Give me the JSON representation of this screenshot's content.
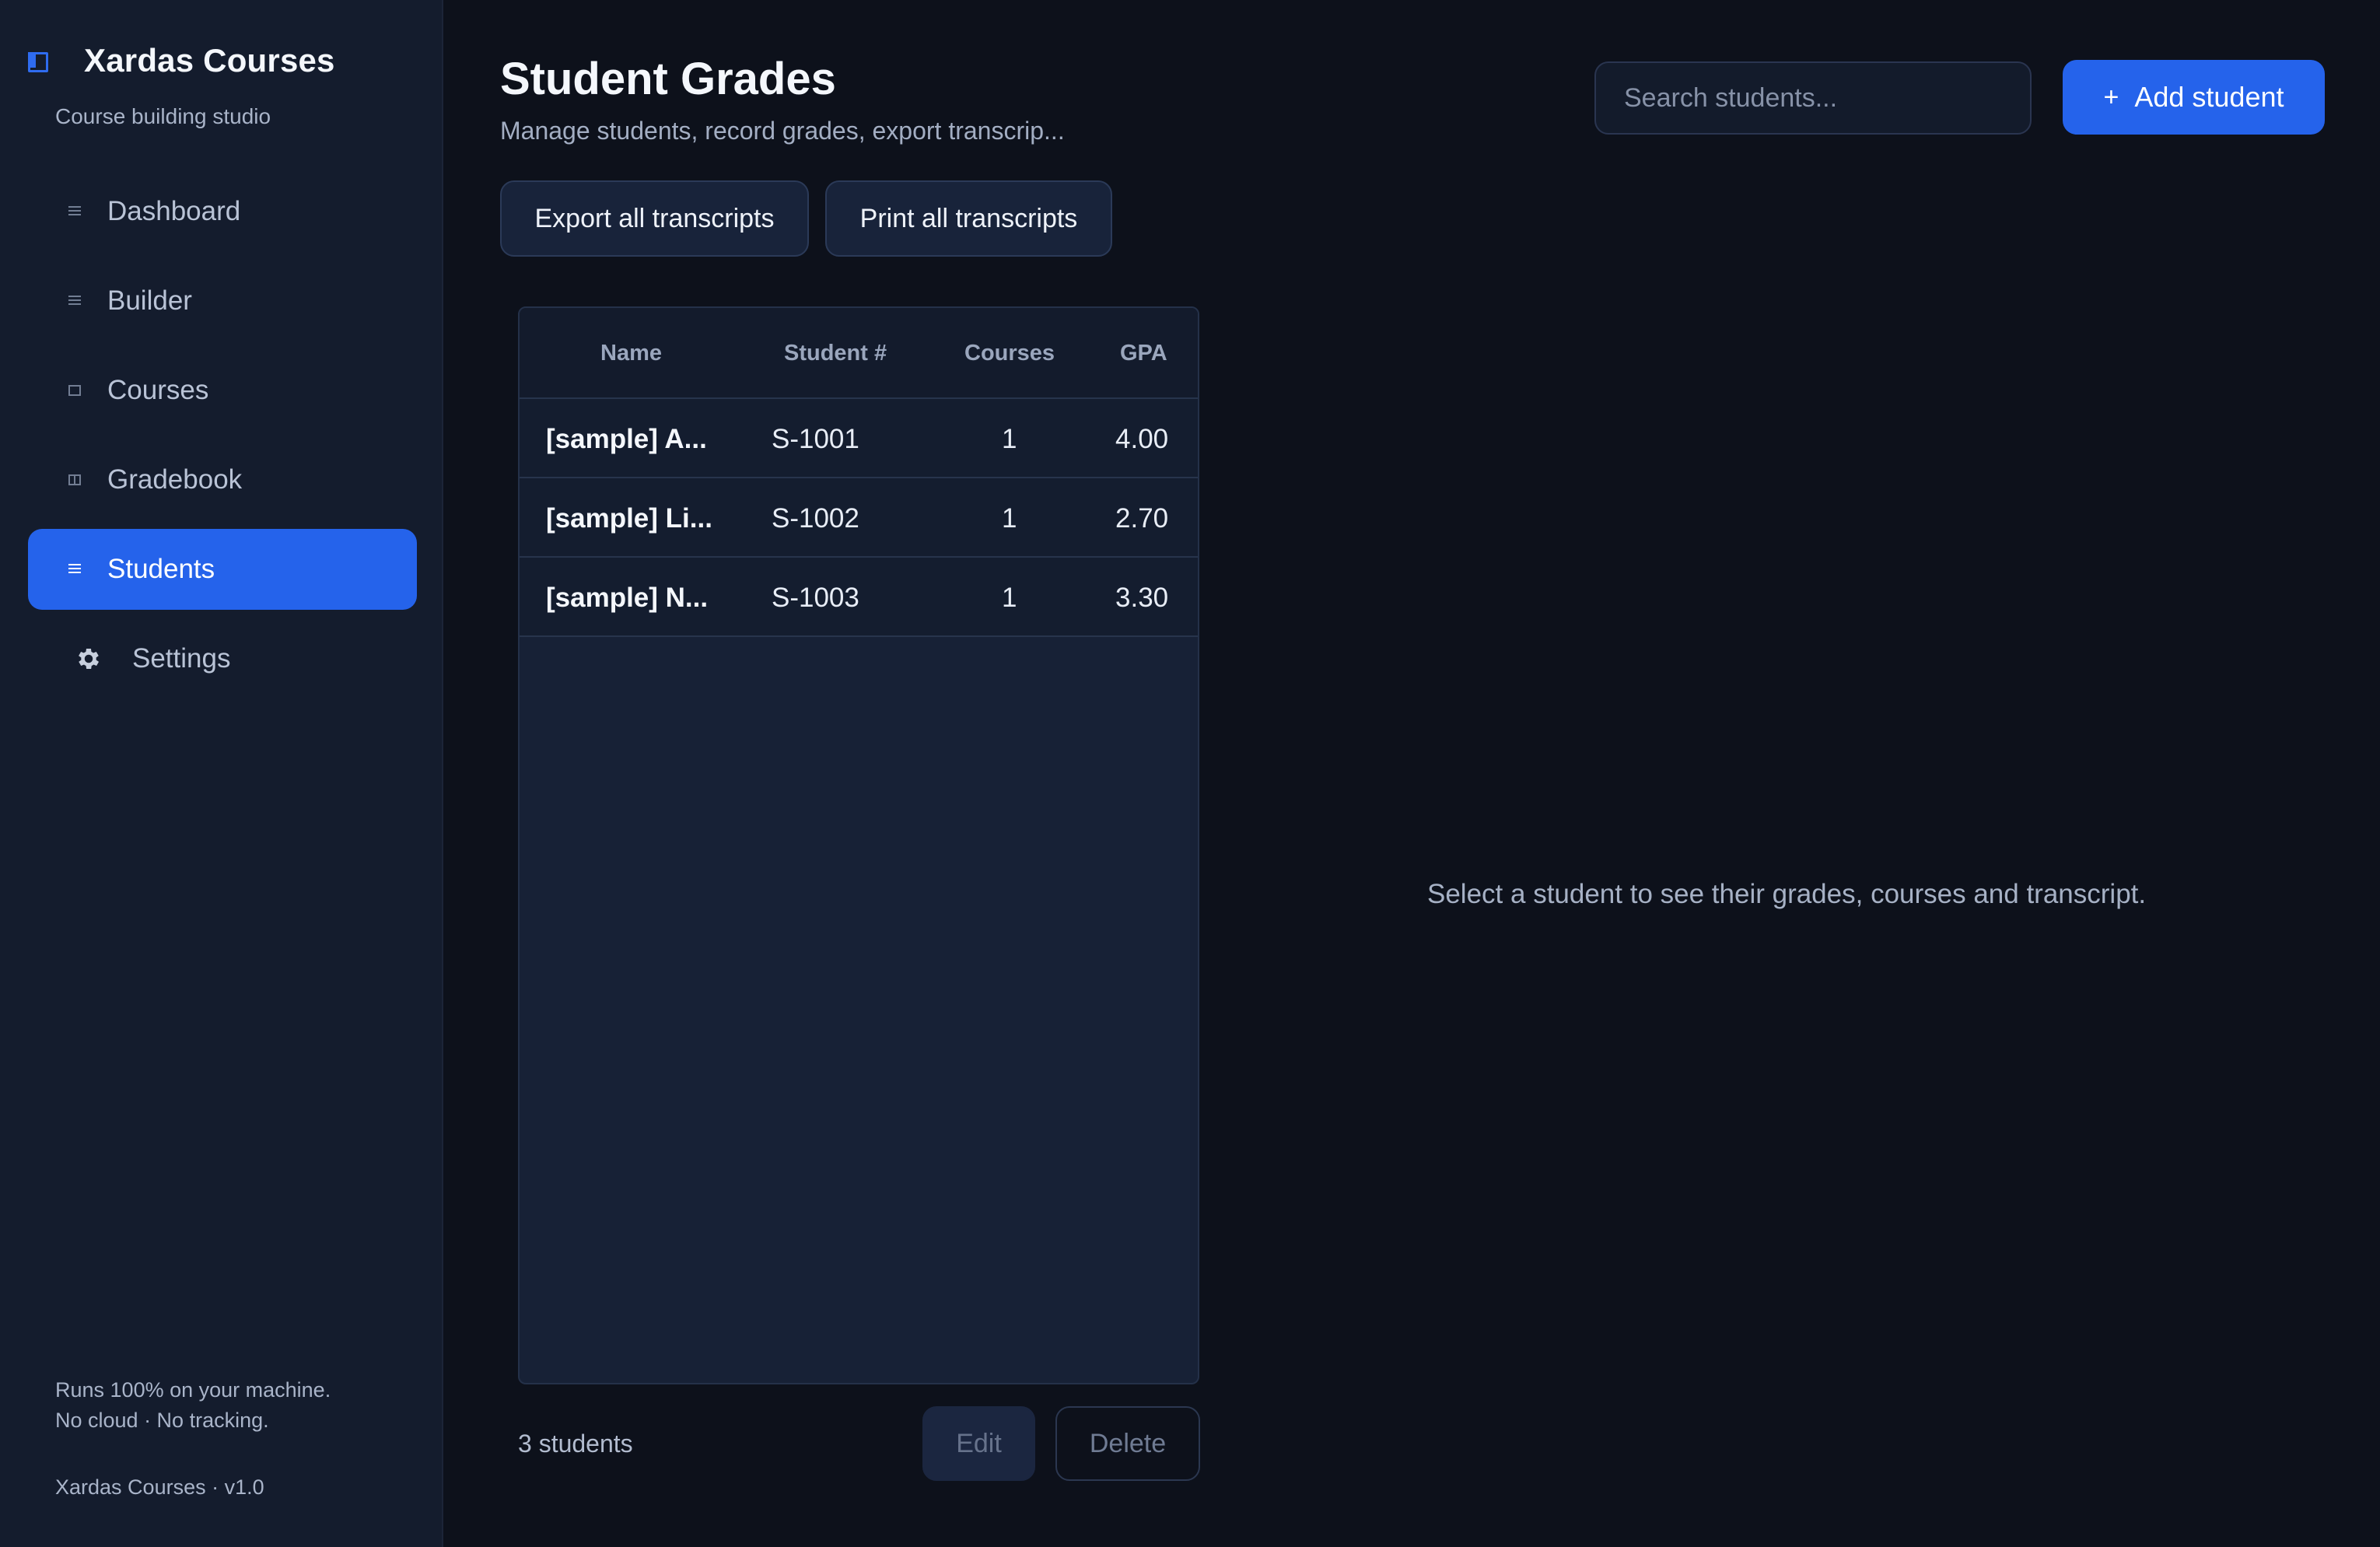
{
  "brand": {
    "title": "Xardas Courses",
    "subtitle": "Course building studio"
  },
  "nav": {
    "items": [
      {
        "label": "Dashboard",
        "icon": "dashboard-icon"
      },
      {
        "label": "Builder",
        "icon": "builder-icon"
      },
      {
        "label": "Courses",
        "icon": "courses-icon"
      },
      {
        "label": "Gradebook",
        "icon": "gradebook-icon"
      },
      {
        "label": "Students",
        "icon": "students-icon",
        "active": true
      },
      {
        "label": "Settings",
        "icon": "gear-icon"
      }
    ]
  },
  "footer": {
    "line1": "Runs 100% on your machine.",
    "line2": "No cloud · No tracking.",
    "version": "Xardas Courses · v1.0"
  },
  "header": {
    "title": "Student Grades",
    "subtitle": "Manage students, record grades, export transcrip...",
    "search_placeholder": "Search students...",
    "add_button": "Add student",
    "add_icon": "+"
  },
  "actions": {
    "export_all": "Export all transcripts",
    "print_all": "Print all transcripts"
  },
  "table": {
    "columns": [
      "Name",
      "Student #",
      "Courses",
      "GPA"
    ],
    "rows": [
      {
        "name": "[sample] A...",
        "number": "S-1001",
        "courses": "1",
        "gpa": "4.00"
      },
      {
        "name": "[sample] Li...",
        "number": "S-1002",
        "courses": "1",
        "gpa": "2.70"
      },
      {
        "name": "[sample] N...",
        "number": "S-1003",
        "courses": "1",
        "gpa": "3.30"
      }
    ]
  },
  "bottom": {
    "count": "3 students",
    "edit": "Edit",
    "delete": "Delete"
  },
  "detail": {
    "empty_message": "Select a student to see their grades, courses and transcript."
  },
  "colors": {
    "accent": "#2563eb",
    "background": "#0d111b",
    "sidebar": "#141c2d"
  }
}
